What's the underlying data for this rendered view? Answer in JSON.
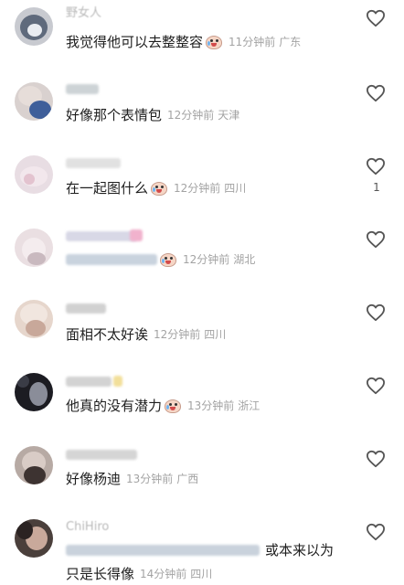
{
  "comments": [
    {
      "name": "野女人",
      "text": "我觉得他可以去整整容",
      "emoji": true,
      "time": "11分钟前",
      "location": "广东",
      "likes": ""
    },
    {
      "name": "",
      "text": "好像那个表情包",
      "emoji": false,
      "time": "12分钟前",
      "location": "天津",
      "likes": ""
    },
    {
      "name": "",
      "text": "在一起图什么",
      "emoji": true,
      "time": "12分钟前",
      "location": "四川",
      "likes": "1"
    },
    {
      "name": "",
      "text": "",
      "emoji": true,
      "time": "12分钟前",
      "location": "湖北",
      "likes": ""
    },
    {
      "name": "",
      "text": "面相不太好诶",
      "emoji": false,
      "time": "12分钟前",
      "location": "四川",
      "likes": ""
    },
    {
      "name": "",
      "text": "他真的没有潜力",
      "emoji": true,
      "time": "13分钟前",
      "location": "浙江",
      "likes": ""
    },
    {
      "name": "",
      "text": "好像杨迪",
      "emoji": false,
      "time": "13分钟前",
      "location": "广西",
      "likes": ""
    },
    {
      "name": "ChiHiro",
      "text": "或本来以为",
      "text2": "只是长得像",
      "emoji": false,
      "time": "14分钟前",
      "location": "四川",
      "likes": ""
    }
  ],
  "icons": {
    "like": "heart-outline-icon",
    "emoji": "crying-face-emoji-icon"
  },
  "colors": {
    "meta": "#a3a3a3",
    "name": "#b9b9b9",
    "text": "#1e1e1e",
    "heart": "#555555"
  }
}
